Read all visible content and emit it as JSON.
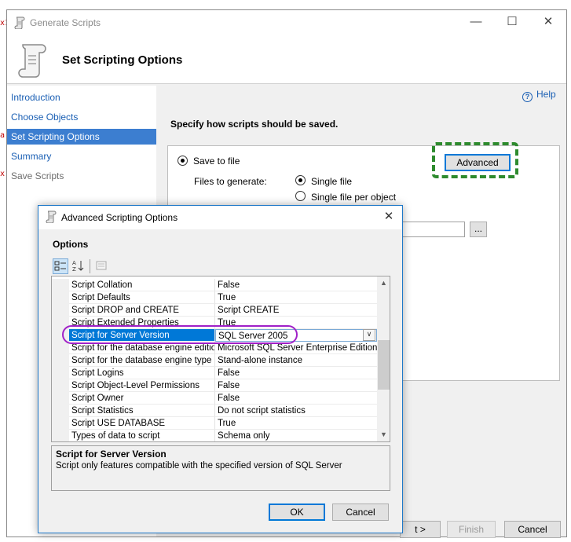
{
  "main_window": {
    "title": "Generate Scripts",
    "page_title": "Set Scripting Options",
    "nav_items": [
      {
        "label": "Introduction",
        "state": "link"
      },
      {
        "label": "Choose Objects",
        "state": "link"
      },
      {
        "label": "Set Scripting Options",
        "state": "selected"
      },
      {
        "label": "Summary",
        "state": "link"
      },
      {
        "label": "Save Scripts",
        "state": "disabled"
      }
    ],
    "help_label": "Help",
    "instruction": "Specify how scripts should be saved.",
    "save_to_file_label": "Save to file",
    "advanced_label": "Advanced",
    "files_to_generate_label": "Files to generate:",
    "single_file_label": "Single file",
    "single_file_per_object_label": "Single file per object",
    "browse_label": "...",
    "next_label": "t >",
    "finish_label": "Finish",
    "cancel_label": "Cancel"
  },
  "advanced_dialog": {
    "title": "Advanced Scripting Options",
    "options_heading": "Options",
    "properties": [
      {
        "name": "Script Collation",
        "value": "False"
      },
      {
        "name": "Script Defaults",
        "value": "True"
      },
      {
        "name": "Script DROP and CREATE",
        "value": "Script CREATE"
      },
      {
        "name": "Script Extended Properties",
        "value": "True"
      },
      {
        "name": "Script for Server Version",
        "value": "SQL Server 2005",
        "selected": true
      },
      {
        "name": "Script for the database engine edition",
        "value": "Microsoft SQL Server Enterprise Edition"
      },
      {
        "name": "Script for the database engine type",
        "value": "Stand-alone instance"
      },
      {
        "name": "Script Logins",
        "value": "False"
      },
      {
        "name": "Script Object-Level Permissions",
        "value": "False"
      },
      {
        "name": "Script Owner",
        "value": "False"
      },
      {
        "name": "Script Statistics",
        "value": "Do not script statistics"
      },
      {
        "name": "Script USE DATABASE",
        "value": "True"
      },
      {
        "name": "Types of data to script",
        "value": "Schema only"
      }
    ],
    "description_title": "Script for Server Version",
    "description_text": "Script only features compatible with the specified version of SQL Server",
    "ok_label": "OK",
    "cancel_label": "Cancel"
  },
  "colors": {
    "selection_blue": "#0078d7",
    "nav_selected": "#3c7ed0",
    "highlight_green": "#2e8b2e",
    "highlight_purple": "#a020c8"
  },
  "icons": [
    "scroll-icon",
    "help-icon",
    "close-icon",
    "minimize-icon",
    "maximize-icon",
    "categorized-icon",
    "alphabetical-icon",
    "property-pages-icon"
  ]
}
